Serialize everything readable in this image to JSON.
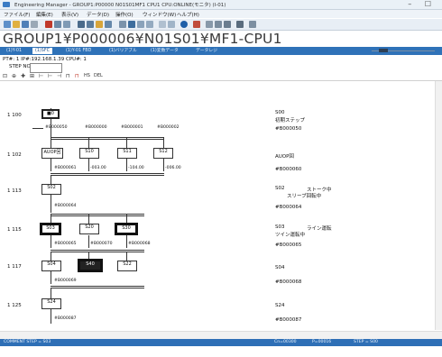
{
  "window": {
    "title": "Engineering Manager - GROUP1:P00000 N01S01MF1 CPU1 CPU:ONLINE(モニタ) (I-01)",
    "controls": "–  ☐"
  },
  "menu": [
    "ファイル(F)",
    "編集(E)",
    "表示(V)",
    "データ(D)",
    "操作(O)",
    "ウィンドウ(W)",
    "ヘルプ(H)"
  ],
  "program_path": "GROUP1¥P000006¥N01S01¥MF1-CPU1",
  "tabs": [
    {
      "label": "(1)Y-01",
      "active": false
    },
    {
      "label": "(1)SFC",
      "active": true
    },
    {
      "label": "(1)Y-01 FBD",
      "active": false
    },
    {
      "label": "(1)バリアブル",
      "active": false
    },
    {
      "label": "(1)変数データ",
      "active": false
    },
    {
      "label": "データレジ",
      "active": false
    }
  ],
  "plc_info": "PT#: 1  IP#:192.168.1.39  CPU#: 1",
  "step_field": {
    "label": "STEP NO.",
    "value": ""
  },
  "subtoolbar": [
    "⊡",
    "⊕",
    "✚",
    "⊞",
    "⊢",
    "⊢",
    "⊣",
    "⊓",
    "⊓",
    "HS",
    "DEL"
  ],
  "rows": [
    {
      "no": "1 100",
      "left": "■0",
      "right1": "S00",
      "right2": "初期ステップ",
      "trans_items": [
        "#B000050",
        "#B000000",
        "#B000001",
        "#B000002"
      ],
      "trans_right": "#B000050"
    },
    {
      "no": "1 102",
      "left": "AUOP回",
      "mid": [
        "S10",
        "S11",
        "S12"
      ],
      "right1": "AUOP回",
      "right2": "",
      "trans_items": [
        "#B000061",
        "-003.00",
        "-104.00",
        "-006.00"
      ],
      "trans_right": "#B000060"
    },
    {
      "no": "1 113",
      "left": "S02",
      "right1": "S02",
      "right2": "スリーブ回転中",
      "right3": "ストーク中",
      "trans_items": [
        "#B000064"
      ],
      "trans_right": "#B000064"
    },
    {
      "no": "1 115",
      "left": "S03",
      "mid": [
        "S20",
        "S30"
      ],
      "right1": "S03",
      "right2": "ツイン運転中",
      "right3": "ライン運転",
      "trans_items": [
        "#B000065",
        "#B000070",
        "#B000068"
      ],
      "trans_right": "#B000065"
    },
    {
      "no": "1 117",
      "left": "S04",
      "mid": [
        "S40",
        "S22"
      ],
      "right1": "S04",
      "right2": "",
      "trans_items": [
        "#B000069"
      ],
      "trans_right": "#B000068"
    },
    {
      "no": "1 125",
      "left": "S24",
      "right1": "S24",
      "right2": "",
      "trans_items": [
        "#B000087"
      ],
      "trans_right": "#B000087"
    }
  ],
  "status": {
    "left": "COMMENT STEP = S03",
    "mid1": "Cn=00300",
    "mid2": "P=00016",
    "right": "STEP = S00"
  },
  "colors": {
    "tab_bar": "#2f72b8",
    "status_bar": "#2e6fb6",
    "title_text": "#3a3a3a"
  }
}
